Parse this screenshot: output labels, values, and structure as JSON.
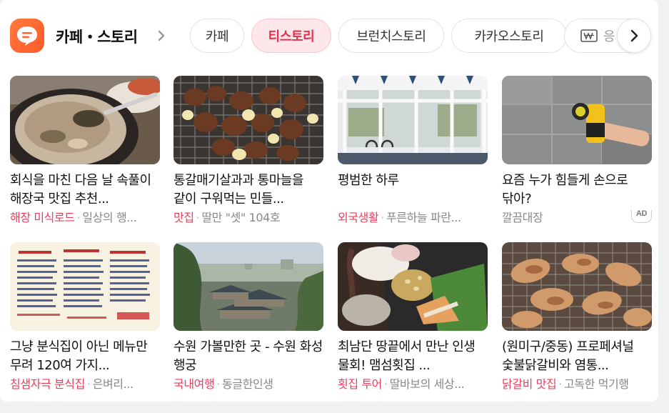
{
  "brand": {
    "title": "카페・스토리",
    "icon": "chat-bubble-icon"
  },
  "tabs": [
    {
      "label": "카페",
      "active": false
    },
    {
      "label": "티스토리",
      "active": true
    },
    {
      "label": "브런치스토리",
      "active": false
    },
    {
      "label": "카카오스토리",
      "active": false
    },
    {
      "label": "응",
      "active": false,
      "icon": "won-icon"
    }
  ],
  "nav": {
    "next_icon": "chevron-right-icon"
  },
  "colors": {
    "accent": "#ea3f5c",
    "active_tab_bg": "#fde7ea",
    "brand": "#ff6a32"
  },
  "items": [
    {
      "title": "회식을 마친 다음 날 속풀이 해장국 맛집 추천...",
      "category": "해장 미식로드",
      "source": "일상의 행...",
      "ad": false
    },
    {
      "title": "통갈매기살과과 통마늘을 같이 구워먹는 민들...",
      "category": "맛집",
      "source": "딸만 \"셋\" 104호",
      "ad": false
    },
    {
      "title": "평범한 하루",
      "category": "외국생활",
      "source": "푸른하늘 파란...",
      "ad": false
    },
    {
      "title": "요즘 누가 힘들게 손으로 닦아?",
      "category": "",
      "source": "깔끔대장",
      "ad": true,
      "ad_label": "AD"
    },
    {
      "title": "그냥 분식집이 아닌 메뉴만 무려 120여 가지...",
      "category": "침샘자극 분식집",
      "source": "은벼리...",
      "ad": false
    },
    {
      "title": "수원 가볼만한 곳 - 수원 화성 행궁",
      "category": "국내여행",
      "source": "동글한인생",
      "ad": false
    },
    {
      "title": "최남단 땅끝에서 만난 인생 물회! 맴섬횟집 ...",
      "category": "횟집 투어",
      "source": "딸바보의 세상...",
      "ad": false
    },
    {
      "title": "(원미구/중동) 프로페셔널 숯불닭갈비와 염통...",
      "category": "닭갈비 맛집",
      "source": "고독한 먹기행",
      "ad": false
    }
  ]
}
